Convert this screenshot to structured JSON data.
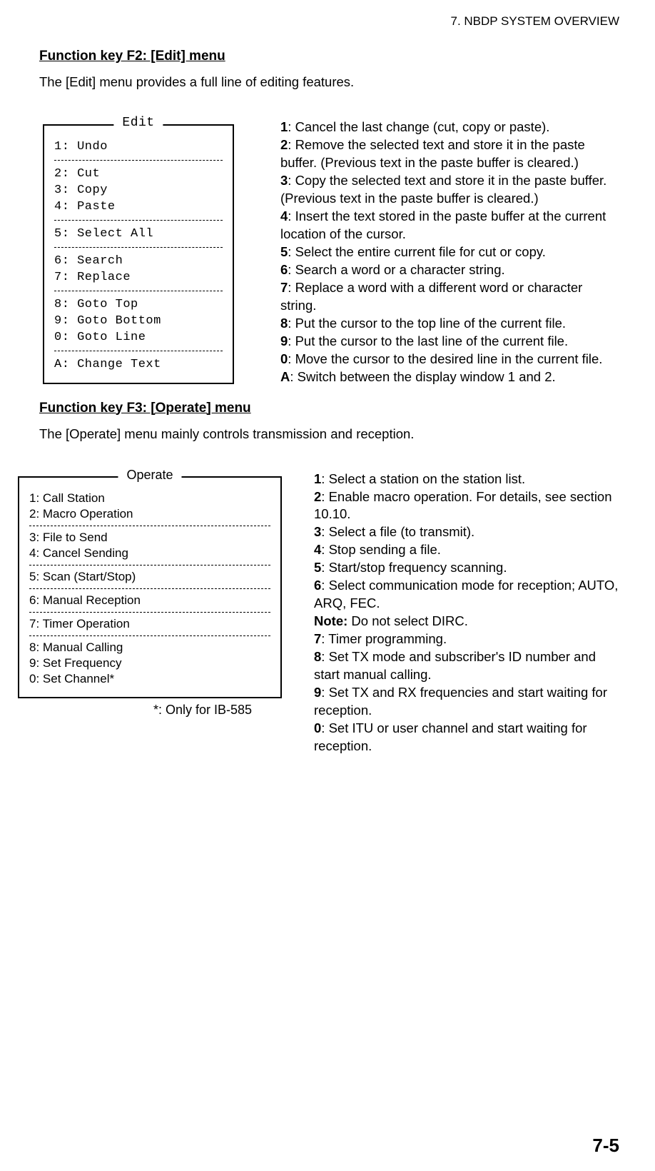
{
  "running_head": "7.  NBDP SYSTEM OVERVIEW",
  "page_number": "7-5",
  "edit_section": {
    "heading": "Function key F2: [Edit] menu",
    "intro": "The [Edit] menu provides a full line of editing features.",
    "menu_legend": "Edit",
    "menu_groups": [
      [
        "1: Undo"
      ],
      [
        "2: Cut",
        "3: Copy",
        "4: Paste"
      ],
      [
        "5: Select All"
      ],
      [
        "6: Search",
        "7: Replace"
      ],
      [
        "8: Goto Top",
        "9: Goto Bottom",
        "0: Goto Line"
      ],
      [
        "A: Change Text"
      ]
    ],
    "descriptions": [
      {
        "k": "1",
        "t": ": Cancel the last change (cut, copy or paste)."
      },
      {
        "k": "2",
        "t": ": Remove the selected text and store it in the paste buffer. (Previous text in the paste buffer is cleared.)"
      },
      {
        "k": "3",
        "t": ": Copy the selected text and store it in the paste buffer. (Previous text in the paste buffer is cleared.)"
      },
      {
        "k": "4",
        "t": ": Insert the text stored in the paste buffer at the current location of the cursor."
      },
      {
        "k": "5",
        "t": ": Select the entire current file for cut or copy."
      },
      {
        "k": "6",
        "t": ": Search a word or a character string."
      },
      {
        "k": "7",
        "t": ": Replace a word with a different word or character string."
      },
      {
        "k": "8",
        "t": ": Put the cursor to the top line of the current file."
      },
      {
        "k": "9",
        "t": ": Put the cursor to the last line of the current file."
      },
      {
        "k": "0",
        "t": ": Move the cursor to the desired line in the current file."
      },
      {
        "k": "A",
        "t": ": Switch between the display window 1 and 2."
      }
    ]
  },
  "operate_section": {
    "heading": "Function key F3: [Operate] menu",
    "intro": "The [Operate] menu mainly controls transmission and reception.",
    "menu_legend": "Operate",
    "menu_groups": [
      [
        "1: Call Station",
        "2: Macro Operation"
      ],
      [
        "3: File to Send",
        "4: Cancel Sending"
      ],
      [
        "5: Scan (Start/Stop)"
      ],
      [
        "6: Manual Reception"
      ],
      [
        "7: Timer Operation"
      ],
      [
        "8: Manual Calling",
        "9: Set Frequency",
        "0: Set Channel*"
      ]
    ],
    "footnote": "*: Only for IB-585",
    "descriptions": [
      {
        "k": "1",
        "t": ": Select a station on the station list."
      },
      {
        "k": "2",
        "t": ": Enable macro operation. For details, see section 10.10."
      },
      {
        "k": "3",
        "t": ": Select a file (to transmit)."
      },
      {
        "k": "4",
        "t": ": Stop sending a file."
      },
      {
        "k": "5",
        "t": ": Start/stop frequency scanning."
      },
      {
        "k": "6",
        "t": ": Select communication mode for reception; AUTO, ARQ, FEC."
      },
      {
        "k": "Note:",
        "t": " Do not select DIRC.",
        "note": true
      },
      {
        "k": "7",
        "t": ": Timer programming."
      },
      {
        "k": "8",
        "t": ": Set TX mode and subscriber's ID number and start manual calling."
      },
      {
        "k": "9",
        "t": ": Set TX and RX frequencies and start waiting for reception."
      },
      {
        "k": "0",
        "t": ": Set ITU or user channel and start waiting for reception."
      }
    ]
  }
}
